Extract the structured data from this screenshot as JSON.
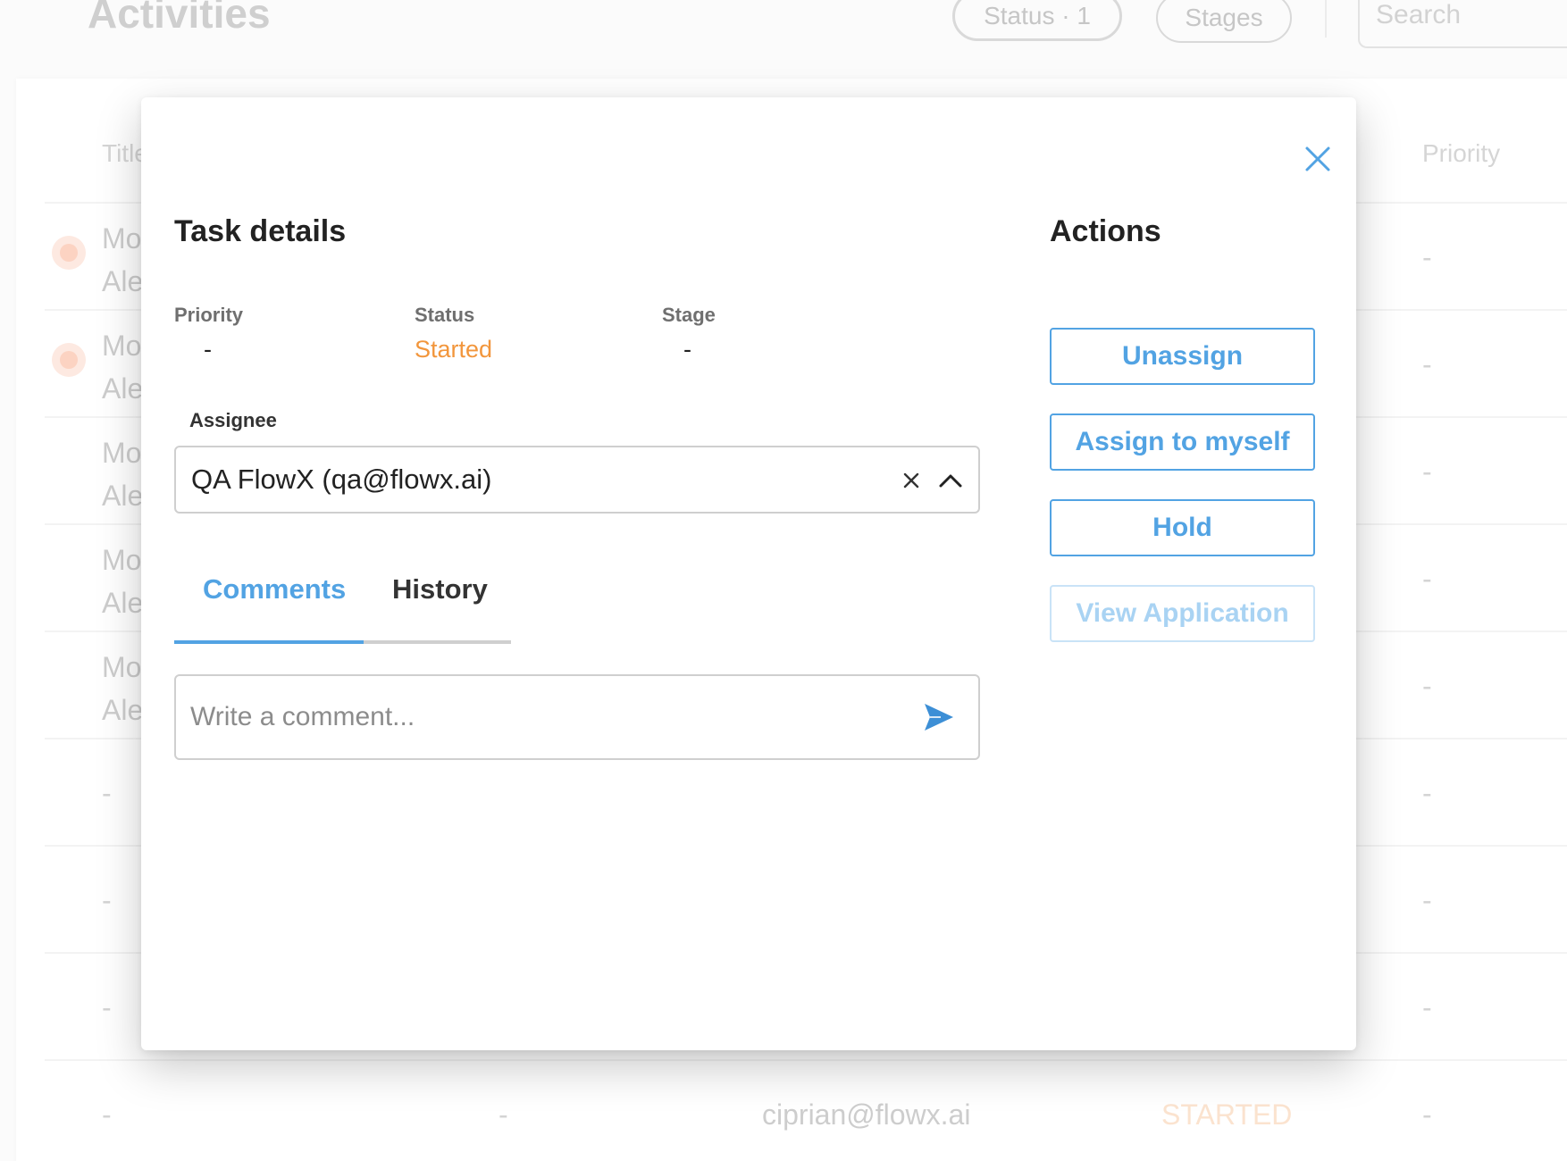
{
  "background": {
    "page_title": "Activities",
    "filters": {
      "status": "Status · 1",
      "stages": "Stages"
    },
    "search_placeholder": "Search",
    "table_headers": {
      "title": "Title",
      "priority": "Priority"
    },
    "rows": [
      {
        "line1": "Mo",
        "line2": "Ale",
        "priority": "-"
      },
      {
        "line1": "Mo",
        "line2": "Ale",
        "priority": "-"
      },
      {
        "line1": "Mo",
        "line2": "Ale",
        "priority": "-"
      },
      {
        "line1": "Mo",
        "line2": "Ale",
        "priority": "-"
      },
      {
        "line1": "Mo",
        "line2": "Ale",
        "priority": "-"
      },
      {
        "line1": "-",
        "priority": "-"
      },
      {
        "line1": "-",
        "priority": "-"
      },
      {
        "line1": "-",
        "priority": "-"
      }
    ],
    "last_row": {
      "col1": "-",
      "col2": "-",
      "assignee": "ciprian@flowx.ai",
      "status": "STARTED",
      "priority": "-"
    }
  },
  "modal": {
    "title": "Task details",
    "actions_title": "Actions",
    "fields": {
      "priority": {
        "label": "Priority",
        "value": "-"
      },
      "status": {
        "label": "Status",
        "value": "Started"
      },
      "stage": {
        "label": "Stage",
        "value": "-"
      }
    },
    "assignee": {
      "label": "Assignee",
      "value": "QA FlowX (qa@flowx.ai)"
    },
    "tabs": [
      {
        "label": "Comments",
        "active": true
      },
      {
        "label": "History",
        "active": false
      }
    ],
    "comment": {
      "placeholder": "Write a comment...",
      "value": ""
    },
    "actions": [
      {
        "label": "Unassign",
        "enabled": true
      },
      {
        "label": "Assign to myself",
        "enabled": true
      },
      {
        "label": "Hold",
        "enabled": true
      },
      {
        "label": "View Application",
        "enabled": false
      }
    ]
  },
  "colors": {
    "accent": "#52a3e3",
    "status_started": "#f2963c",
    "disabled_accent": "#a9d3f3"
  },
  "icons": {
    "close": "close-icon",
    "clear": "clear-icon",
    "chevron": "chevron-up-icon",
    "send": "send-icon"
  }
}
